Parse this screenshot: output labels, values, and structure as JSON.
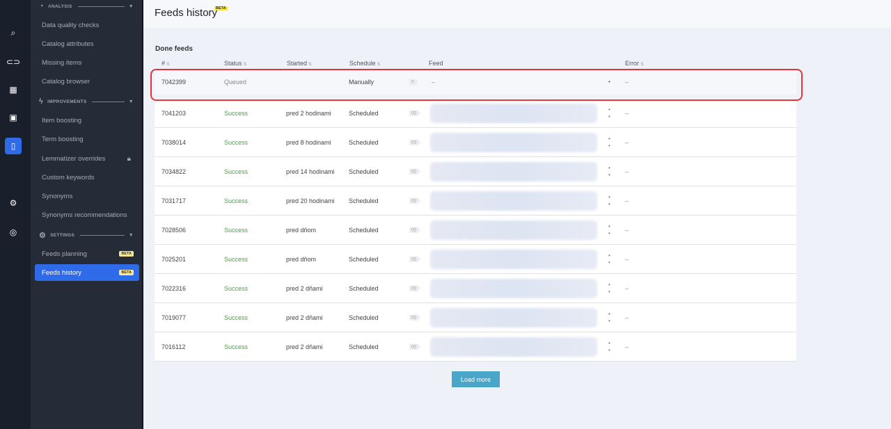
{
  "rail": [
    {
      "icon": "search-icon",
      "g": "⌕"
    },
    {
      "icon": "toggle-icon",
      "g": "⊂⊃"
    },
    {
      "icon": "grid-icon",
      "g": "▦"
    },
    {
      "icon": "image-icon",
      "g": "▣"
    },
    {
      "icon": "book-icon",
      "g": "▯"
    },
    {
      "icon": "gear-icon",
      "g": "⚙"
    },
    {
      "icon": "lifebuoy-icon",
      "g": "◎"
    }
  ],
  "sidebar": {
    "analysis": "ANALYSIS",
    "improvements": "IMPROVEMENTS",
    "settings": "SETTINGS",
    "items": [
      "Data quality checks",
      "Catalog attributes",
      "Missing items",
      "Catalog browser",
      "Item boosting",
      "Term boosting",
      "Lemmatizer overrides",
      "Custom keywords",
      "Synonyms",
      "Synonyms recommendations",
      "Feeds planning",
      "Feeds history"
    ],
    "beta": "BETA"
  },
  "header": {
    "title": "Feeds history",
    "beta": "BETA"
  },
  "section": "Done feeds",
  "columns": [
    "#",
    "Status",
    "Started",
    "Schedule",
    "Feed",
    "Error"
  ],
  "rows": [
    {
      "id": "7042399",
      "status": "Queued",
      "started": "",
      "schedule": "Manually",
      "count": "0",
      "feed": "–",
      "error": "–"
    },
    {
      "id": "7041203",
      "status": "Success",
      "started": "pred 2 hodinami",
      "schedule": "Scheduled",
      "count": "02",
      "error": "–"
    },
    {
      "id": "7038014",
      "status": "Success",
      "started": "pred 8 hodinami",
      "schedule": "Scheduled",
      "count": "02",
      "error": "–"
    },
    {
      "id": "7034822",
      "status": "Success",
      "started": "pred 14 hodinami",
      "schedule": "Scheduled",
      "count": "02",
      "error": "–"
    },
    {
      "id": "7031717",
      "status": "Success",
      "started": "pred 20 hodinami",
      "schedule": "Scheduled",
      "count": "02",
      "error": "–"
    },
    {
      "id": "7028506",
      "status": "Success",
      "started": "pred dňom",
      "schedule": "Scheduled",
      "count": "02",
      "error": "–"
    },
    {
      "id": "7025201",
      "status": "Success",
      "started": "pred dňom",
      "schedule": "Scheduled",
      "count": "02",
      "error": "–"
    },
    {
      "id": "7022316",
      "status": "Success",
      "started": "pred 2 dňami",
      "schedule": "Scheduled",
      "count": "02",
      "error": "–"
    },
    {
      "id": "7019077",
      "status": "Success",
      "started": "pred 2 dňami",
      "schedule": "Scheduled",
      "count": "02",
      "error": "–"
    },
    {
      "id": "7016112",
      "status": "Success",
      "started": "pred 2 dňami",
      "schedule": "Scheduled",
      "count": "02",
      "error": "–"
    }
  ],
  "load_more": "Load more"
}
